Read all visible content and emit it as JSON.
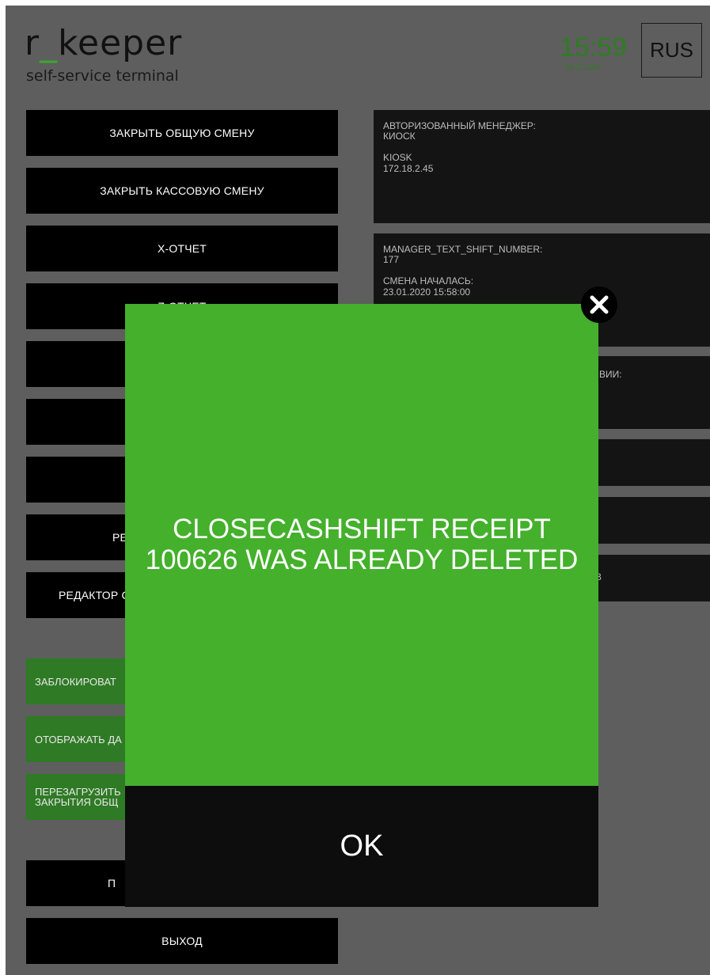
{
  "header": {
    "logo_part1": "r",
    "logo_part2": "_",
    "logo_part3": "keeper",
    "subtitle": "self-service terminal",
    "time": "15:59",
    "date": "23.01.2020",
    "language": "RUS"
  },
  "menu": {
    "close_shift": "ЗАКРЫТЬ ОБЩУЮ СМЕНУ",
    "close_cash_shift": "ЗАКРЫТЬ КАССОВУЮ СМЕНУ",
    "x_report": "X-ОТЧЕТ",
    "z_report": "Z-ОТЧЕТ",
    "editor_partial_1": "РЕ",
    "editor_partial_2": "РЕДАКТОР С",
    "block_partial": "ЗАБЛОКИРОВАТ",
    "display_partial": "ОТОБРАЖАТЬ ДА",
    "reboot_partial_1": "ПЕРЕЗАГРУЗИТЬ",
    "reboot_partial_2": "ЗАКРЫТИЯ ОБЩ",
    "hidden_partial": "П",
    "exit": "ВЫХОД"
  },
  "panels": {
    "manager_label": "АВТОРИЗОВАННЫЙ МЕНЕДЖЕР:",
    "manager_value": "КИОСК",
    "station_name": "KIOSK",
    "station_ip": "172.18.2.45",
    "shift_number_label": "MANAGER_TEXT_SHIFT_NUMBER:",
    "shift_number_value": "177",
    "shift_started_label": "СМЕНА НАЧАЛАСЬ:",
    "shift_started_value": "23.01.2020 15:58:00",
    "partial_label": "ВИИ:",
    "partial_b": "В"
  },
  "modal": {
    "message": "CLOSECASHSHIFT RECEIPT 100626 WAS ALREADY DELETED",
    "ok_label": "OK"
  },
  "colors": {
    "background": "#5e5e5e",
    "modal_green": "#44b02c",
    "accent_green": "#3aa82e",
    "button_black": "#000000"
  }
}
